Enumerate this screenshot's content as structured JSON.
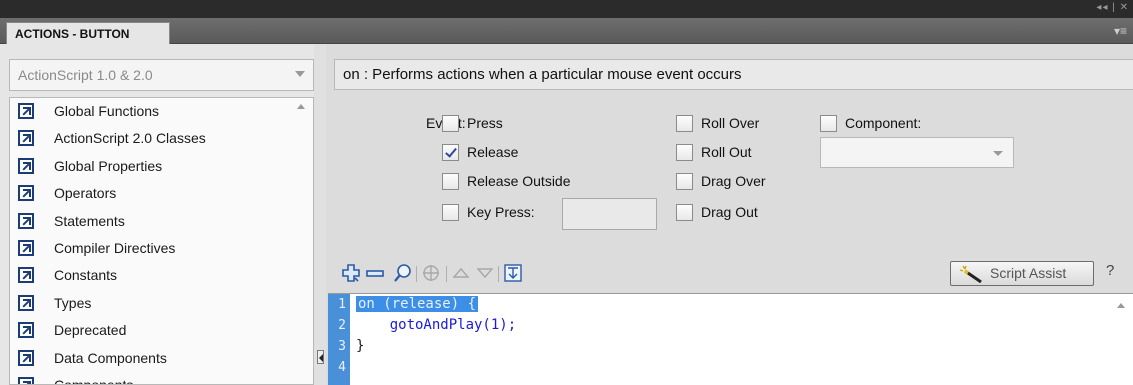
{
  "titlebar": {
    "controls": "◂◂ | ✕"
  },
  "panel": {
    "tab_label": "ACTIONS - BUTTON",
    "menu_icon": "panel-menu-icon"
  },
  "left_panel": {
    "version_select": "ActionScript 1.0 & 2.0",
    "tree_items": [
      {
        "label": "Global Functions",
        "icon": "book-icon"
      },
      {
        "label": "ActionScript 2.0 Classes",
        "icon": "book-icon"
      },
      {
        "label": "Global Properties",
        "icon": "book-icon"
      },
      {
        "label": "Operators",
        "icon": "book-icon"
      },
      {
        "label": "Statements",
        "icon": "book-icon"
      },
      {
        "label": "Compiler Directives",
        "icon": "book-icon"
      },
      {
        "label": "Constants",
        "icon": "book-icon"
      },
      {
        "label": "Types",
        "icon": "book-icon"
      },
      {
        "label": "Deprecated",
        "icon": "book-icon"
      },
      {
        "label": "Data Components",
        "icon": "book-icon"
      },
      {
        "label": "Components",
        "icon": "book-icon"
      }
    ]
  },
  "right_panel": {
    "description": "on : Performs actions when a particular mouse event occurs",
    "event_label": "Event:",
    "events": {
      "press": {
        "label": "Press",
        "checked": false
      },
      "release": {
        "label": "Release",
        "checked": true
      },
      "release_outside": {
        "label": "Release Outside",
        "checked": false
      },
      "key_press": {
        "label": "Key Press:",
        "checked": false
      },
      "roll_over": {
        "label": "Roll Over",
        "checked": false
      },
      "roll_out": {
        "label": "Roll Out",
        "checked": false
      },
      "drag_over": {
        "label": "Drag Over",
        "checked": false
      },
      "drag_out": {
        "label": "Drag Out",
        "checked": false
      },
      "component": {
        "label": "Component:",
        "checked": false
      }
    },
    "key_press_value": "",
    "component_value": "",
    "toolbar": {
      "add": "add-statement-icon",
      "remove": "remove-statement-icon",
      "find": "find-icon",
      "target": "insert-target-path-icon",
      "move_up": "move-up-icon",
      "move_down": "move-down-icon",
      "pin": "pin-script-icon"
    },
    "script_assist_label": "Script Assist",
    "help_label": "?"
  },
  "editor": {
    "lines": [
      {
        "number": "1",
        "text": "on (release) {"
      },
      {
        "number": "2",
        "text": "    gotoAndPlay(1);"
      },
      {
        "number": "3",
        "text": "}"
      },
      {
        "number": "4",
        "text": ""
      }
    ]
  },
  "colors": {
    "gutter": "#4a90d9",
    "selection": "#3d8ee6",
    "keyword": "#1a1adc",
    "tree_icon": "#1c3c78"
  }
}
